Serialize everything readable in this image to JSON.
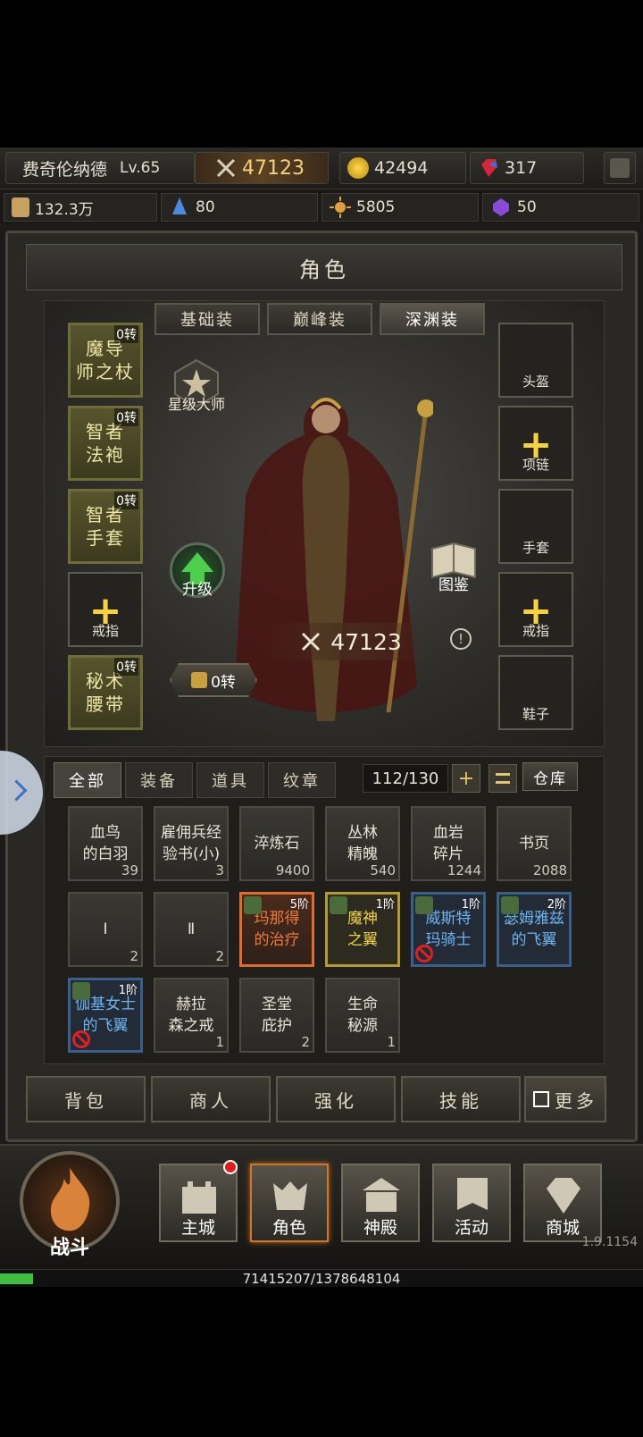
{
  "player": {
    "name": "费奇伦纳德",
    "level": "Lv.65",
    "power": "47123"
  },
  "resources": {
    "gold": "42494",
    "gems": "317"
  },
  "stats": {
    "fortune": "132.3万",
    "crystal": "80",
    "honor": "5805",
    "rune": "50"
  },
  "panel_title": "角色",
  "equip_tabs": [
    "基础装",
    "巅峰装",
    "深渊装"
  ],
  "left_slots": [
    {
      "label": "魔导\n师之杖",
      "tag": "0转"
    },
    {
      "label": "智者\n法袍",
      "tag": "0转"
    },
    {
      "label": "智者\n手套",
      "tag": "0转"
    },
    {
      "label": "戒指",
      "tag": ""
    },
    {
      "label": "秘术\n腰带",
      "tag": "0转"
    }
  ],
  "right_slots": [
    "头盔",
    "项链",
    "手套",
    "戒指",
    "鞋子"
  ],
  "star_label": "星级大师",
  "upgrade_label": "升级",
  "codex_label": "图鉴",
  "character_power": "47123",
  "info_mark": "!",
  "reincarnation": "0转",
  "inventory": {
    "tabs": [
      "全部",
      "装备",
      "道具",
      "纹章"
    ],
    "count": "112/130",
    "plus": "+",
    "warehouse": "仓库",
    "items": [
      {
        "name": "血鸟\n的白羽",
        "qty": "39",
        "style": "plain"
      },
      {
        "name": "雇佣兵经\n验书(小)",
        "qty": "3",
        "style": "plain"
      },
      {
        "name": "淬炼石",
        "qty": "9400",
        "style": "plain"
      },
      {
        "name": "丛林\n精魄",
        "qty": "540",
        "style": "plain"
      },
      {
        "name": "血岩\n碎片",
        "qty": "1244",
        "style": "plain"
      },
      {
        "name": "书页",
        "qty": "2088",
        "style": "plain"
      },
      {
        "name": "Ⅰ",
        "qty": "2",
        "style": "plain"
      },
      {
        "name": "Ⅱ",
        "qty": "2",
        "style": "plain"
      },
      {
        "name": "玛那得\n的治疗",
        "qty": "",
        "lvl": "5阶",
        "style": "orange"
      },
      {
        "name": "魔神\n之翼",
        "qty": "",
        "lvl": "1阶",
        "style": "yellow"
      },
      {
        "name": "威斯特\n玛骑士",
        "qty": "",
        "lvl": "1阶",
        "style": "blue"
      },
      {
        "name": "瑟姆雅兹\n的飞翼",
        "qty": "",
        "lvl": "2阶",
        "style": "blue"
      },
      {
        "name": "伽基女士\n的飞翼",
        "qty": "",
        "lvl": "1阶",
        "style": "blue"
      },
      {
        "name": "赫拉\n森之戒",
        "qty": "1",
        "style": "plain"
      },
      {
        "name": "圣堂\n庇护",
        "qty": "2",
        "style": "plain"
      },
      {
        "name": "生命\n秘源",
        "qty": "1",
        "style": "plain"
      }
    ]
  },
  "actions": [
    "背包",
    "商人",
    "强化",
    "技能",
    "更多"
  ],
  "nav": {
    "battle": "战斗",
    "items": [
      "主城",
      "角色",
      "神殿",
      "活动",
      "商城"
    ]
  },
  "version": "1.9.1154",
  "xp": {
    "text": "71415207/1378648104",
    "fraction": 0.052
  }
}
